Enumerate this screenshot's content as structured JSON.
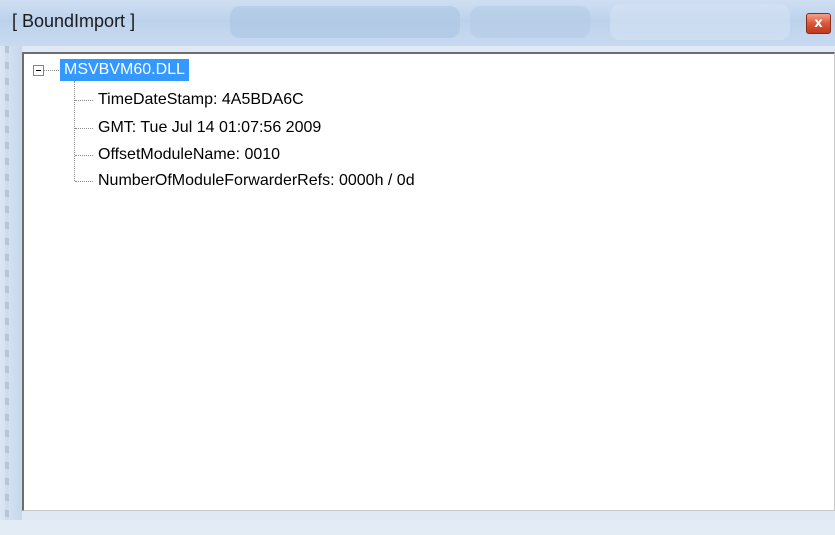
{
  "window": {
    "title": "[ BoundImport ]",
    "close_glyph": "x"
  },
  "tree": {
    "root": {
      "label": "MSVBVM60.DLL",
      "expander_icon": "minus-box-icon",
      "selected": true,
      "selection_color": "#3399ff",
      "children": [
        {
          "label": "TimeDateStamp: 4A5BDA6C"
        },
        {
          "label": "GMT: Tue Jul 14 01:07:56 2009"
        },
        {
          "label": "OffsetModuleName: 0010"
        },
        {
          "label": "NumberOfModuleForwarderRefs: 0000h / 0d"
        }
      ]
    }
  }
}
